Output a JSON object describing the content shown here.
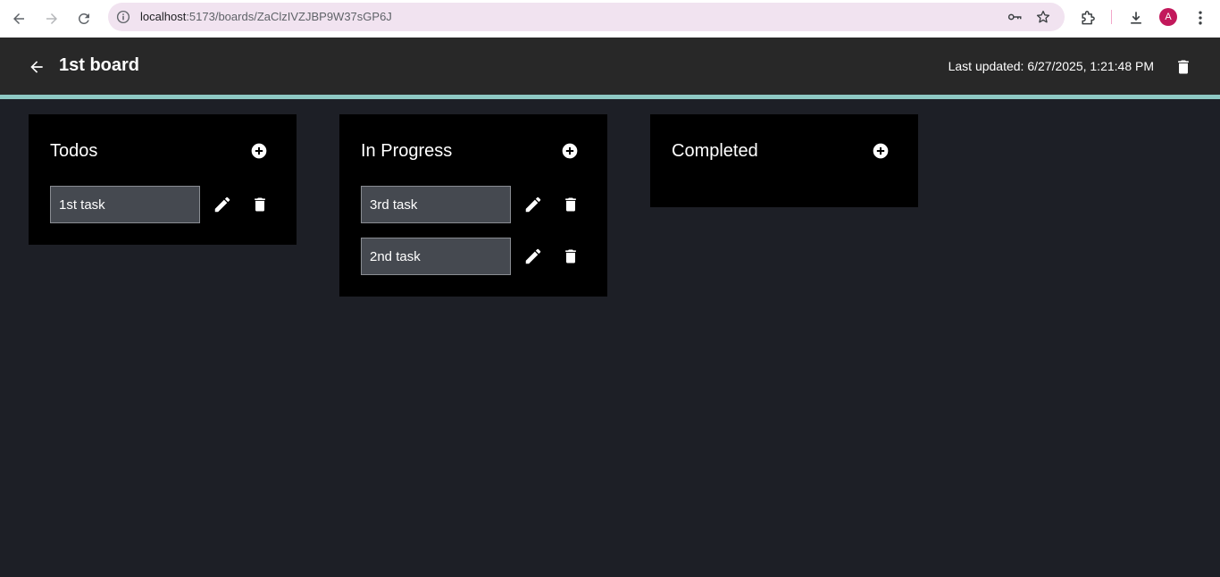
{
  "browser": {
    "url_host": "localhost",
    "url_path": ":5173/boards/ZaClzIVZJBP9W37sGP6J",
    "avatar_letter": "A",
    "icons": [
      "back-icon",
      "forward-icon",
      "reload-icon",
      "site-info-icon",
      "password-key-icon",
      "bookmark-star-icon",
      "extensions-icon",
      "download-icon",
      "menu-icon"
    ]
  },
  "header": {
    "title": "1st board",
    "last_updated": "Last updated: 6/27/2025, 1:21:48 PM"
  },
  "columns": [
    {
      "title": "Todos",
      "tasks": [
        "1st task"
      ]
    },
    {
      "title": "In Progress",
      "tasks": [
        "3rd task",
        "2nd task"
      ]
    },
    {
      "title": "Completed",
      "tasks": []
    }
  ],
  "colors": {
    "page_bg": "#1d1f26",
    "header_bg": "#282828",
    "accent_line": "#8ec9c4",
    "column_bg": "#000000",
    "task_bg": "#454950",
    "omnibox_bg": "#f1e3f0",
    "avatar_bg": "#c2185b"
  }
}
